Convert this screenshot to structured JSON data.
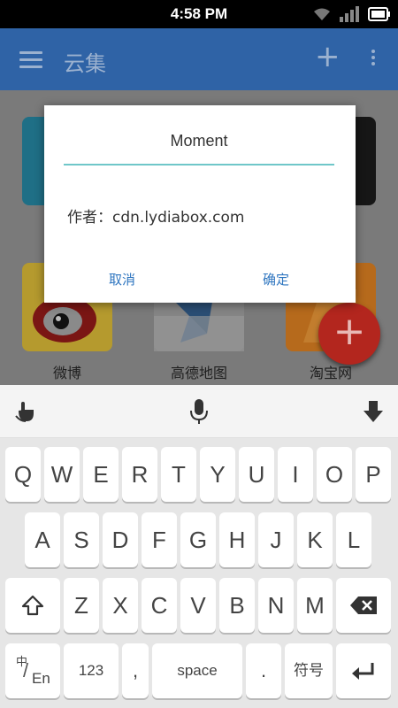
{
  "status_bar": {
    "time": "4:58 PM"
  },
  "app_bar": {
    "title": "云集"
  },
  "grid": {
    "items": [
      {
        "label": "微博"
      },
      {
        "label": "高德地图"
      },
      {
        "label": "淘宝网"
      }
    ]
  },
  "dialog": {
    "name_value": "Moment",
    "author_text": "作者：cdn.lydiabox.com",
    "cancel_label": "取消",
    "confirm_label": "确定"
  },
  "keyboard": {
    "row1": [
      "Q",
      "W",
      "E",
      "R",
      "T",
      "Y",
      "U",
      "I",
      "O",
      "P"
    ],
    "row2": [
      "A",
      "S",
      "D",
      "F",
      "G",
      "H",
      "J",
      "K",
      "L"
    ],
    "row3": [
      "Z",
      "X",
      "C",
      "V",
      "B",
      "N",
      "M"
    ],
    "lang_top": "中",
    "lang_bottom": "En",
    "numbers_label": "123",
    "comma_label": ",",
    "space_label": "space",
    "period_label": ".",
    "symbols_label": "符号"
  },
  "colors": {
    "app_bar": "#2f63a6",
    "accent_underline": "#6fc7c9",
    "dialog_button": "#2f76c0",
    "fab": "#b3261e"
  }
}
